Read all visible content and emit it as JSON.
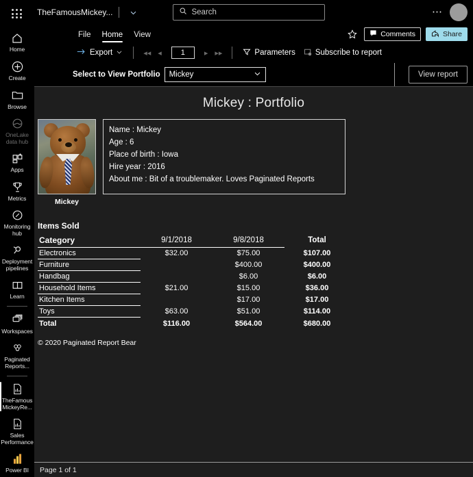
{
  "topbar": {
    "waffle_icon": "app-launcher-icon",
    "app_title": "TheFamousMickey...",
    "chevron_icon": "chevron-down-icon",
    "search": {
      "icon": "search-icon",
      "placeholder": "Search",
      "value": ""
    },
    "more_icon": "ellipsis-icon",
    "avatar": "user-avatar"
  },
  "ribbon": {
    "tabs": [
      {
        "label": "File",
        "active": false
      },
      {
        "label": "Home",
        "active": true
      },
      {
        "label": "View",
        "active": false
      }
    ],
    "favorite_icon": "star-icon",
    "comments": {
      "label": "Comments",
      "icon": "comment-icon"
    },
    "share": {
      "label": "Share",
      "icon": "share-icon",
      "bg": "#9edbeb"
    }
  },
  "toolbar": {
    "export": {
      "label": "Export",
      "icon": "export-arrow-icon",
      "chevron": "chevron-down-icon"
    },
    "nav": {
      "first_icon": "first-page-icon",
      "prev_icon": "previous-page-icon",
      "page_value": "1",
      "next_icon": "next-page-icon",
      "last_icon": "last-page-icon"
    },
    "parameters": {
      "label": "Parameters",
      "icon": "filter-icon"
    },
    "subscribe": {
      "label": "Subscribe to report",
      "icon": "subscribe-icon"
    }
  },
  "parameter_bar": {
    "label": "Select to View Portfolio",
    "select_value": "Mickey",
    "select_chevron": "chevron-down-icon",
    "view_report_label": "View report"
  },
  "sidebar": {
    "items": [
      {
        "label": "Home",
        "icon": "home-icon",
        "selected": false,
        "dim": false
      },
      {
        "label": "Create",
        "icon": "plus-circle-icon",
        "selected": false,
        "dim": false
      },
      {
        "label": "Browse",
        "icon": "folder-icon",
        "selected": false,
        "dim": false
      },
      {
        "label": "OneLake data hub",
        "icon": "onelake-icon",
        "selected": false,
        "dim": true
      },
      {
        "label": "Apps",
        "icon": "apps-icon",
        "selected": false,
        "dim": false
      },
      {
        "label": "Metrics",
        "icon": "trophy-icon",
        "selected": false,
        "dim": false
      },
      {
        "label": "Monitoring hub",
        "icon": "monitoring-icon",
        "selected": false,
        "dim": false
      },
      {
        "label": "Deployment pipelines",
        "icon": "deployment-pipelines-icon",
        "selected": false,
        "dim": false
      },
      {
        "label": "Learn",
        "icon": "learn-book-icon",
        "selected": false,
        "dim": false
      },
      {
        "label": "Workspaces",
        "icon": "workspaces-icon",
        "selected": false,
        "dim": false
      },
      {
        "label": "Paginated Reports...",
        "icon": "paginated-reports-icon",
        "selected": false,
        "dim": false
      },
      {
        "label": "TheFamous MickeyRe...",
        "icon": "report-file-icon",
        "selected": true,
        "dim": false
      },
      {
        "label": "Sales Performance",
        "icon": "report-file-icon",
        "selected": false,
        "dim": false
      },
      {
        "label": "Power BI",
        "icon": "power-bi-icon",
        "selected": false,
        "dim": false
      }
    ]
  },
  "report": {
    "title": "Mickey : Portfolio",
    "photo": {
      "alt": "teddy-bear-photo",
      "caption": "Mickey"
    },
    "info_lines": [
      "Name : Mickey",
      "Age : 6",
      "Place of birth : Iowa",
      "Hire year : 2016",
      "About me : Bit of a troublemaker.  Loves Paginated Reports"
    ],
    "items_sold_title": "Items Sold",
    "table": {
      "headers": [
        "Category",
        "9/1/2018",
        "9/8/2018",
        "Total"
      ],
      "rows": [
        {
          "category": "Electronics",
          "d1": "$32.00",
          "d2": "$75.00",
          "total": "$107.00"
        },
        {
          "category": "Furniture",
          "d1": "",
          "d2": "$400.00",
          "total": "$400.00"
        },
        {
          "category": "Handbag",
          "d1": "",
          "d2": "$6.00",
          "total": "$6.00"
        },
        {
          "category": "Household Items",
          "d1": "$21.00",
          "d2": "$15.00",
          "total": "$36.00"
        },
        {
          "category": "Kitchen Items",
          "d1": "",
          "d2": "$17.00",
          "total": "$17.00"
        },
        {
          "category": "Toys",
          "d1": "$63.00",
          "d2": "$51.00",
          "total": "$114.00"
        }
      ],
      "total_row": {
        "category": "Total",
        "d1": "$116.00",
        "d2": "$564.00",
        "total": "$680.00"
      }
    },
    "copyright": "© 2020 Paginated Report Bear"
  },
  "statusbar": {
    "page_text": "Page 1 of 1"
  }
}
